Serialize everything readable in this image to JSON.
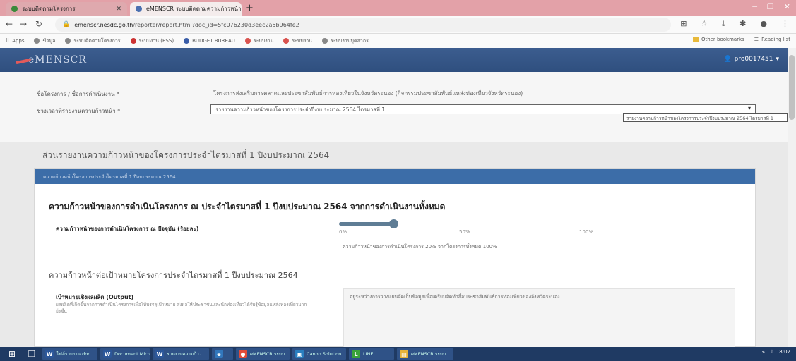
{
  "browser": {
    "tabs": [
      {
        "label": "ระบบติดตามโครงการ",
        "active": false
      },
      {
        "label": "eMENSCR ระบบติดตามความก้าวหน้า",
        "active": true
      }
    ],
    "new_tab_icon": "plus-icon",
    "address": {
      "host": "emenscr.nesdc.go.th",
      "path": "/reporter/report.html?doc_id=5fc076230d3eec2a5b964fe2"
    },
    "bookmarks": [
      "Apps",
      "ข้อมูล",
      "ระบบติดตามโครงการ",
      "ระบบงาน (ESS)",
      "BUDGET BUREAU",
      "ระบบงาน",
      "ระบบงาน",
      "ระบบงานบุคลากร"
    ],
    "bookmarks_right": [
      "Other bookmarks",
      "Reading list"
    ]
  },
  "app": {
    "logo": "eMENSCR",
    "user": "pro0017451"
  },
  "form": {
    "project_label": "ชื่อโครงการ / ชื่อการดำเนินงาน *",
    "project_value": "โครงการส่งเสริมการตลาดและประชาสัมพันธ์การท่องเที่ยวในจังหวัดระนอง (กิจกรรมประชาสัมพันธ์แหล่งท่องเที่ยวจังหวัดระนอง)",
    "period_label": "ช่วงเวลาที่รายงานความก้าวหน้า *",
    "period_value": "รายงานความก้าวหน้าของโครงการประจำปีงบประมาณ 2564 ไตรมาสที่ 1",
    "period_tooltip": "รายงานความก้าวหน้าของโครงการประจำปีงบประมาณ 2564 ไตรมาสที่ 1"
  },
  "section_title": "ส่วนรายงานความก้าวหน้าของโครงการประจำไตรมาสที่ 1 ปีงบประมาณ 2564",
  "panel": {
    "header": "ความก้าวหน้าโครงการประจำไตรมาสที่ 1 ปีงบประมาณ 2564",
    "heading": "ความก้าวหน้าของการดำเนินโครงการ ณ ประจำไตรมาสที่ 1 ปีงบประมาณ 2564 จากการดำเนินงานทั้งหมด",
    "progress_label": "ความก้าวหน้าของการดำเนินโครงการ ณ ปัจจุบัน (ร้อยละ)",
    "progress_value": 20,
    "ticks": [
      "0%",
      "50%",
      "100%"
    ],
    "progress_note": "ความก้าวหน้าของการดำเนินโครงการ 20% จากโครงการทั้งหมด 100%",
    "subheading": "ความก้าวหน้าต่อเป้าหมายโครงการประจำไตรมาสที่ 1 ปีงบประมาณ 2564",
    "output_label": "เป้าหมายเชิงผลผลิต (Output)",
    "output_desc": "ผลผลิตที่เกิดขึ้นจากการดำเนินโครงการเพื่อให้บรรลุเป้าหมาย ส่งผลให้ประชาชนและนักท่องเที่ยวได้รับรู้ข้อมูลแหล่งท่องเที่ยวมากยิ่งขึ้น",
    "output_text": "อยู่ระหว่างการวางแผนจัดเก็บข้อมูลเพื่อเตรียมจัดทำสื่อประชาสัมพันธ์การท่องเที่ยวของจังหวัดระนอง"
  },
  "taskbar": {
    "items": [
      {
        "label": "ไฟล์รายงาน.doc",
        "icon": "W",
        "color": "#2b579a"
      },
      {
        "label": "Document Micro...",
        "icon": "W",
        "color": "#2b579a"
      },
      {
        "label": "รายงานความก้าว...",
        "icon": "W",
        "color": "#2b579a"
      },
      {
        "label": "",
        "icon": "e",
        "color": "#3277bc"
      },
      {
        "label": "eMENSCR ระบบ...",
        "icon": "●",
        "color": "#e04b3a"
      },
      {
        "label": "Canon Solution...",
        "icon": "▣",
        "color": "#2a7fc0"
      },
      {
        "label": "LINE",
        "icon": "L",
        "color": "#3aa33a"
      },
      {
        "label": "eMENSCR ระบบ",
        "icon": "▤",
        "color": "#e7b43a"
      }
    ],
    "clock": "8:02"
  },
  "colors": {
    "header_bg": "#2f4f7f",
    "panel_head_bg": "#3c6da8",
    "slider": "#5f7d95"
  }
}
